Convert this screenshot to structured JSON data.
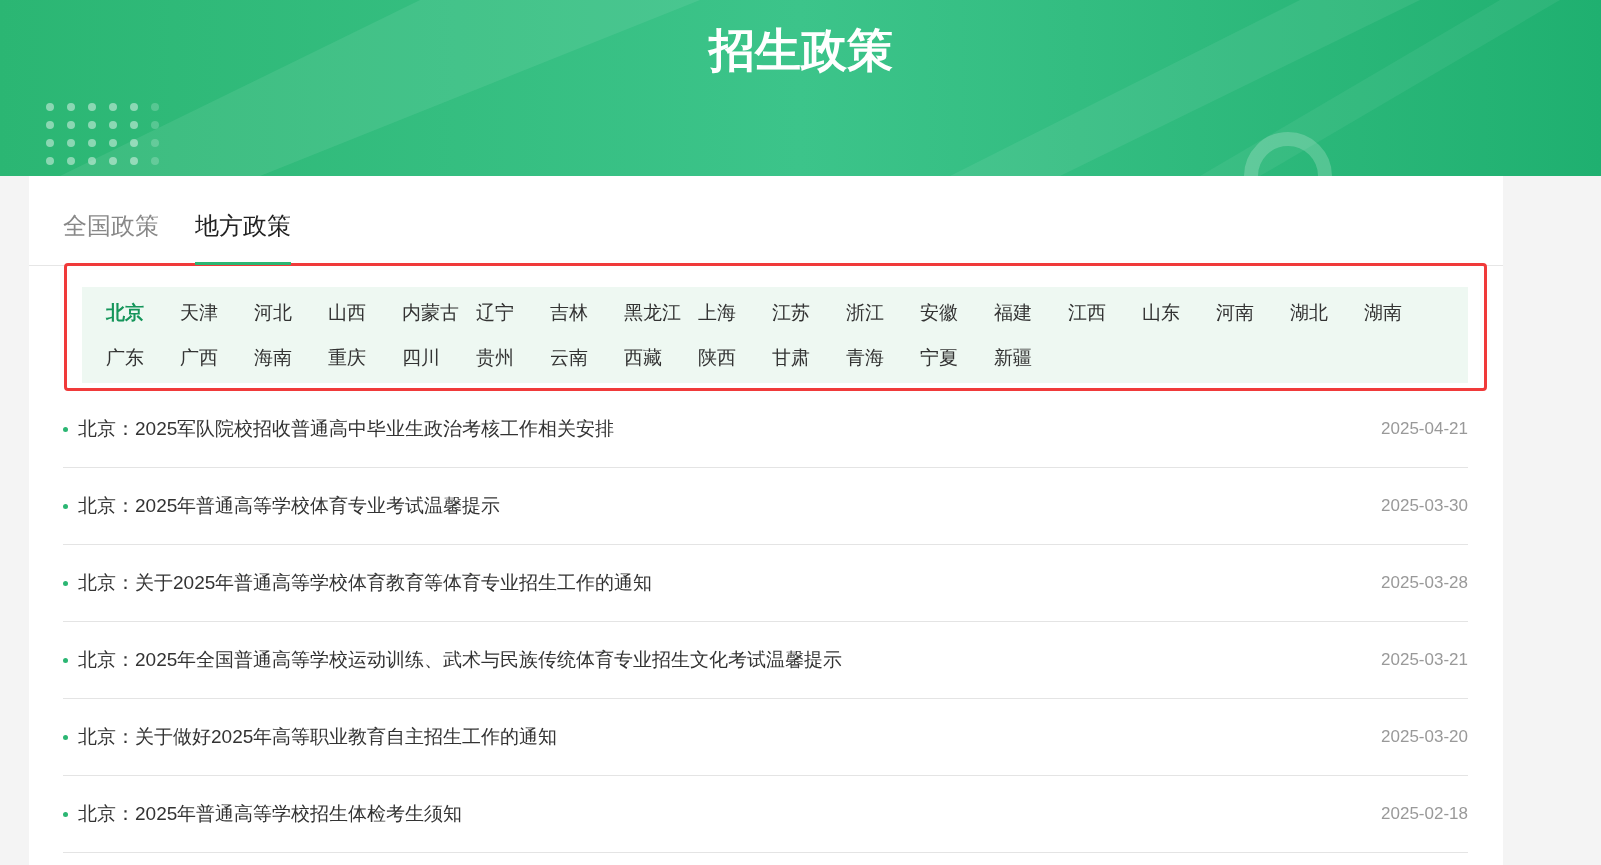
{
  "header": {
    "title": "招生政策"
  },
  "tabs": [
    {
      "label": "全国政策",
      "selected": false
    },
    {
      "label": "地方政策",
      "selected": true
    }
  ],
  "regions": [
    {
      "label": "北京",
      "selected": true
    },
    {
      "label": "天津",
      "selected": false
    },
    {
      "label": "河北",
      "selected": false
    },
    {
      "label": "山西",
      "selected": false
    },
    {
      "label": "内蒙古",
      "selected": false
    },
    {
      "label": "辽宁",
      "selected": false
    },
    {
      "label": "吉林",
      "selected": false
    },
    {
      "label": "黑龙江",
      "selected": false
    },
    {
      "label": "上海",
      "selected": false
    },
    {
      "label": "江苏",
      "selected": false
    },
    {
      "label": "浙江",
      "selected": false
    },
    {
      "label": "安徽",
      "selected": false
    },
    {
      "label": "福建",
      "selected": false
    },
    {
      "label": "江西",
      "selected": false
    },
    {
      "label": "山东",
      "selected": false
    },
    {
      "label": "河南",
      "selected": false
    },
    {
      "label": "湖北",
      "selected": false
    },
    {
      "label": "湖南",
      "selected": false
    },
    {
      "label": "广东",
      "selected": false
    },
    {
      "label": "广西",
      "selected": false
    },
    {
      "label": "海南",
      "selected": false
    },
    {
      "label": "重庆",
      "selected": false
    },
    {
      "label": "四川",
      "selected": false
    },
    {
      "label": "贵州",
      "selected": false
    },
    {
      "label": "云南",
      "selected": false
    },
    {
      "label": "西藏",
      "selected": false
    },
    {
      "label": "陕西",
      "selected": false
    },
    {
      "label": "甘肃",
      "selected": false
    },
    {
      "label": "青海",
      "selected": false
    },
    {
      "label": "宁夏",
      "selected": false
    },
    {
      "label": "新疆",
      "selected": false
    }
  ],
  "articles": [
    {
      "title": "北京：2025军队院校招收普通高中毕业生政治考核工作相关安排",
      "date": "2025-04-21"
    },
    {
      "title": "北京：2025年普通高等学校体育专业考试温馨提示",
      "date": "2025-03-30"
    },
    {
      "title": "北京：关于2025年普通高等学校体育教育等体育专业招生工作的通知",
      "date": "2025-03-28"
    },
    {
      "title": "北京：2025年全国普通高等学校运动训练、武术与民族传统体育专业招生文化考试温馨提示",
      "date": "2025-03-21"
    },
    {
      "title": "北京：关于做好2025年高等职业教育自主招生工作的通知",
      "date": "2025-03-20"
    },
    {
      "title": "北京：2025年普通高等学校招生体检考生须知",
      "date": "2025-02-18"
    }
  ]
}
